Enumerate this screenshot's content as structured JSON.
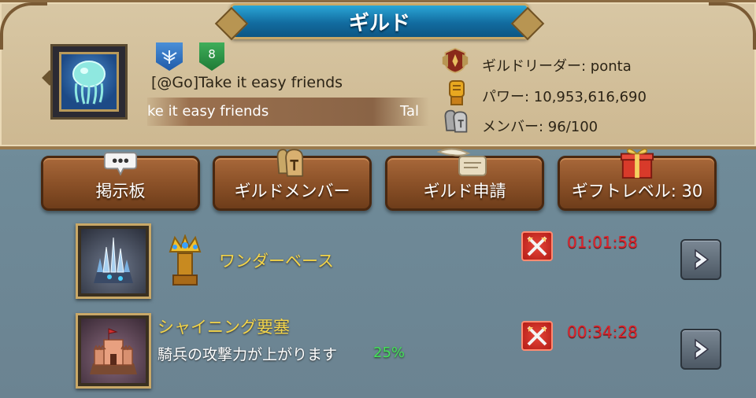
{
  "header": {
    "title": "ギルド"
  },
  "guild": {
    "emblem_icon": "jellyfish-emblem-icon",
    "rank_icon": "wing-rank-badge-icon",
    "level": "8",
    "name": "[@Go]Take it easy friends",
    "ticker_text": "ke it easy friends",
    "ticker_text_repeat": "Tal"
  },
  "stats": {
    "leader": "ギルドリーダー: ponta",
    "power": "パワー: 10,953,616,690",
    "members": "メンバー: 96/100"
  },
  "actions": [
    {
      "label": "掲示板",
      "icon": "speech-bubble-icon"
    },
    {
      "label": "ギルドメンバー",
      "icon": "helmet-icon"
    },
    {
      "label": "ギルド申請",
      "icon": "quill-scroll-icon"
    },
    {
      "label": "ギフトレベル: 30",
      "icon": "gift-icon"
    }
  ],
  "rows": [
    {
      "title": "ワンダーベース",
      "timer": "01:01:58",
      "thumb_icon": "wonder-base-icon"
    },
    {
      "title": "シャイニング要塞",
      "description": "騎兵の攻撃力が上がります",
      "percent": "25%",
      "timer": "00:34:28",
      "thumb_icon": "fortress-icon"
    }
  ],
  "colors": {
    "title_bar": "#1a7fb5",
    "frame": "#d8c7a4",
    "button": "#8b5128",
    "timer": "#e0242c",
    "row_title": "#f2d44a",
    "percent": "#45e05a"
  }
}
